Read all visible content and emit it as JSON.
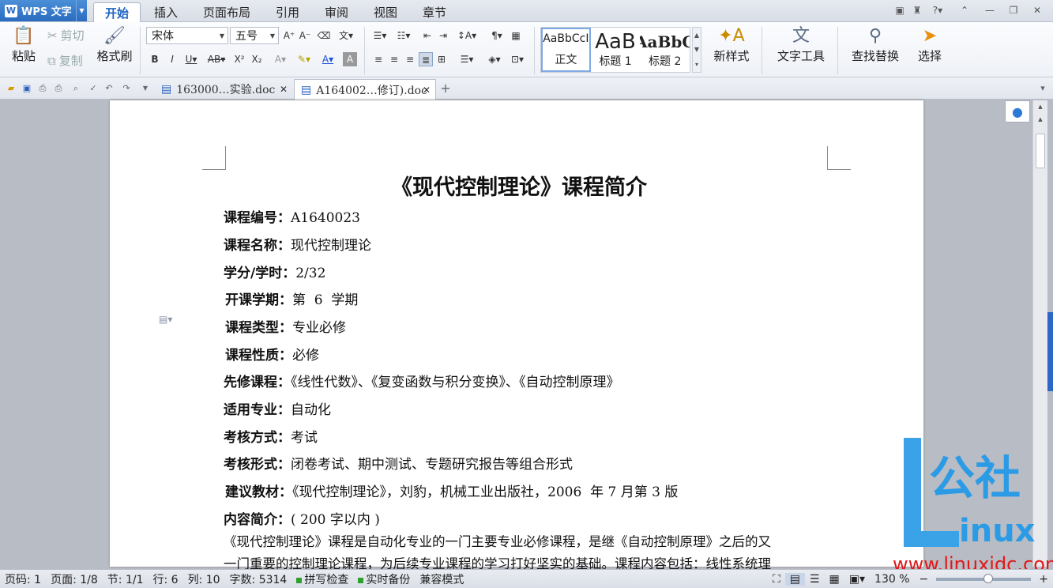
{
  "app": {
    "name": "WPS 文字"
  },
  "menu_tabs": [
    "开始",
    "插入",
    "页面布局",
    "引用",
    "审阅",
    "视图",
    "章节"
  ],
  "ribbon": {
    "paste": "粘贴",
    "cut": "剪切",
    "copy": "复制",
    "format_painter": "格式刷",
    "font_name": "宋体",
    "font_size": "五号",
    "styles": [
      {
        "preview": "AaBbCcI",
        "label": "正文"
      },
      {
        "preview": "AaB",
        "label": "标题 1"
      },
      {
        "preview": "AaBbC",
        "label": "标题 2"
      }
    ],
    "new_style": "新样式",
    "text_tools": "文字工具",
    "find_replace": "查找替换",
    "select": "选择"
  },
  "doc_tabs": [
    {
      "name": "163000…实验.doc",
      "active": false
    },
    {
      "name": "A164002…修订).doc",
      "active": true
    }
  ],
  "document": {
    "title": "《现代控制理论》课程简介",
    "fields": [
      {
        "label": "课程编号：",
        "value": "A1640023"
      },
      {
        "label": "课程名称：",
        "value": "现代控制理论"
      },
      {
        "label": "学分/学时：",
        "value": "2/32"
      },
      {
        "label": "开课学期：",
        "value": "第  6  学期"
      },
      {
        "label": "课程类型：",
        "value": "专业必修"
      },
      {
        "label": "课程性质：",
        "value": "必修"
      },
      {
        "label": "先修课程：",
        "value": "《线性代数》、《复变函数与积分变换》、《自动控制原理》"
      },
      {
        "label": "适用专业：",
        "value": "自动化"
      },
      {
        "label": "考核方式：",
        "value": "考试"
      },
      {
        "label": "考核形式：",
        "value": "闭卷考试、期中测试、专题研究报告等组合形式"
      },
      {
        "label": "建议教材：",
        "value": "《现代控制理论》，刘豹，机械工业出版社，2006  年 7 月第 3 版"
      },
      {
        "label": "内容简介：",
        "value": "( 200 字以内 )"
      }
    ],
    "body_lines": [
      "《现代控制理论》课程是自动化专业的一门主要专业必修课程，是继《自动控制原理》之后的又",
      "一门重要的控制理论课程，为后续专业课程的学习打好坚实的基础。课程内容包括：线性系统理"
    ]
  },
  "status": {
    "page_no": "页码: 1",
    "pages": "页面: 1/8",
    "section": "节: 1/1",
    "row": "行: 6",
    "col": "列: 10",
    "words": "字数: 5314",
    "spell_check": "拼写检查",
    "backup": "实时备份",
    "compat": "兼容模式",
    "zoom": "130 %"
  },
  "watermark": {
    "top": "公社",
    "bottom": "inux",
    "url": "www.linuxidc.com"
  }
}
